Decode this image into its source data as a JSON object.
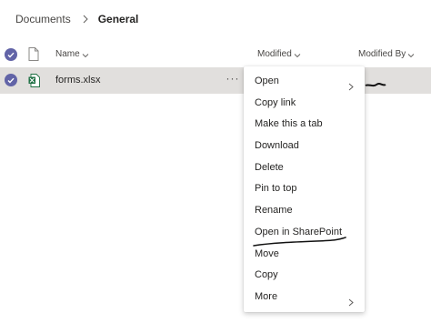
{
  "breadcrumb": {
    "root": "Documents",
    "current": "General"
  },
  "columns": {
    "name": "Name",
    "modified": "Modified",
    "modified_by": "Modified By"
  },
  "files": [
    {
      "name": "forms.xlsx",
      "icon": "excel-file-icon",
      "more": "···"
    }
  ],
  "context_menu": {
    "items": [
      {
        "label": "Open",
        "has_submenu": true
      },
      {
        "label": "Copy link",
        "has_submenu": false
      },
      {
        "label": "Make this a tab",
        "has_submenu": false
      },
      {
        "label": "Download",
        "has_submenu": false
      },
      {
        "label": "Delete",
        "has_submenu": false
      },
      {
        "label": "Pin to top",
        "has_submenu": false
      },
      {
        "label": "Rename",
        "has_submenu": false
      },
      {
        "label": "Open in SharePoint",
        "has_submenu": false
      },
      {
        "label": "Move",
        "has_submenu": false
      },
      {
        "label": "Copy",
        "has_submenu": false
      },
      {
        "label": "More",
        "has_submenu": true
      }
    ]
  },
  "colors": {
    "accent": "#6264a7",
    "row_selected": "#e1dfdd",
    "excel_green": "#1d6f42"
  }
}
